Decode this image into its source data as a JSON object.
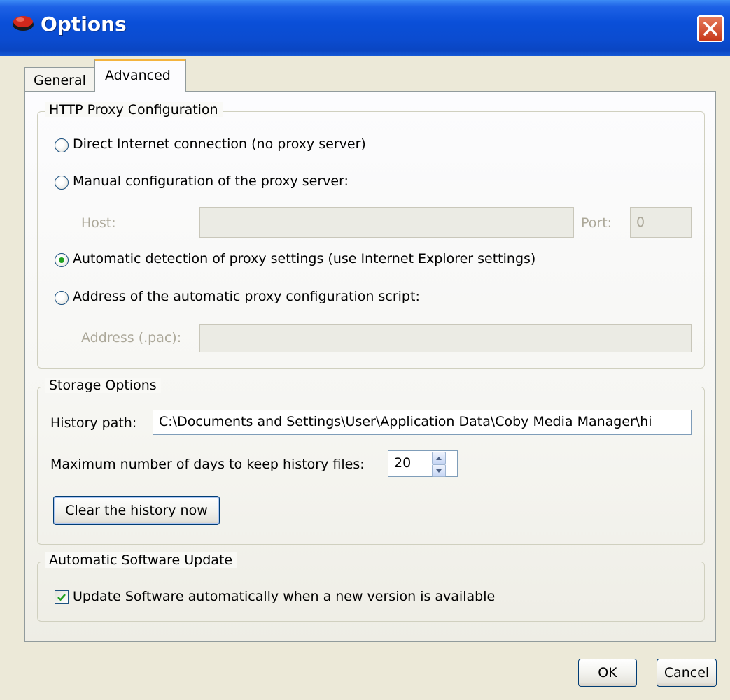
{
  "window": {
    "title": "Options"
  },
  "tabs": [
    {
      "label": "General",
      "active": false
    },
    {
      "label": "Advanced",
      "active": true
    }
  ],
  "proxy": {
    "legend": "HTTP Proxy Configuration",
    "options": [
      {
        "label": "Direct Internet connection (no proxy server)",
        "selected": false
      },
      {
        "label": "Manual configuration of the proxy server:",
        "selected": false
      },
      {
        "label": "Automatic detection of proxy settings (use Internet Explorer settings)",
        "selected": true
      },
      {
        "label": "Address of the automatic proxy configuration script:",
        "selected": false
      }
    ],
    "host_label": "Host:",
    "host_value": "",
    "port_label": "Port:",
    "port_value": "0",
    "address_label": "Address (.pac):",
    "address_value": ""
  },
  "storage": {
    "legend": "Storage Options",
    "history_path_label": "History path:",
    "history_path_value": "C:\\Documents and Settings\\User\\Application Data\\Coby Media Manager\\hi",
    "max_days_label": "Maximum number of days to keep history files:",
    "max_days_value": "20",
    "clear_button": "Clear the history now"
  },
  "update": {
    "legend": "Automatic Software Update",
    "checkbox_label": "Update Software automatically when a new version is available",
    "checked": true
  },
  "footer": {
    "ok": "OK",
    "cancel": "Cancel"
  },
  "icons": [
    "app-icon",
    "close-icon",
    "spin-up-icon",
    "spin-down-icon",
    "checkmark-icon"
  ],
  "colors": {
    "titlebar": "#0a4fd8",
    "active_tab_accent": "#f4b43e",
    "radio_selected": "#21a121",
    "window_bg": "#ece9d8"
  }
}
